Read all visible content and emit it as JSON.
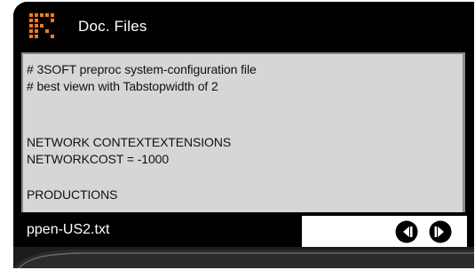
{
  "header": {
    "title": "Doc. Files",
    "logo_icon": "pixel-grid-logo-icon",
    "accent_color": "#ff7a1a"
  },
  "document": {
    "lines": [
      "# 3SOFT preproc system-configuration file",
      "# best viewn with Tabstopwidth of 2",
      "",
      "",
      "NETWORK CONTEXTEXTENSIONS",
      "NETWORKCOST = -1000",
      "",
      "PRODUCTIONS"
    ]
  },
  "status": {
    "filename": "ppen-US2.txt",
    "prev_icon": "previous-arrow-icon",
    "next_icon": "next-arrow-icon"
  }
}
